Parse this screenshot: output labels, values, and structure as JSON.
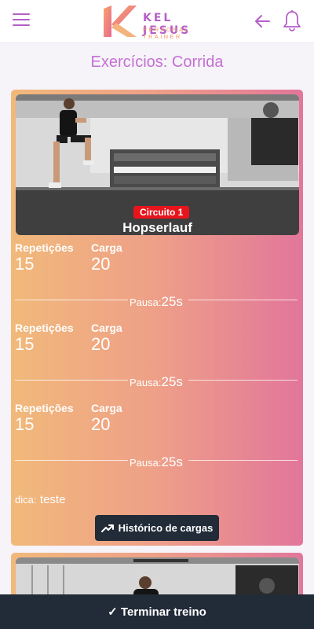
{
  "header": {
    "logo_title": "KEL JESUS",
    "logo_subtitle": "PERSONAL TRAINER",
    "menu_icon": "hamburger-menu-icon",
    "back_icon": "arrow-left-icon",
    "notification_icon": "bell-icon"
  },
  "page_title": "Exercícios: Corrida",
  "exercise": {
    "circuit_label": "Circuito 1",
    "name": "Hopserlauf",
    "sets": [
      {
        "reps_label": "Repetições",
        "reps_value": "15",
        "load_label": "Carga",
        "load_value": "20"
      },
      {
        "reps_label": "Repetições",
        "reps_value": "15",
        "load_label": "Carga",
        "load_value": "20"
      },
      {
        "reps_label": "Repetições",
        "reps_value": "15",
        "load_label": "Carga",
        "load_value": "20"
      }
    ],
    "rests": [
      {
        "label": "Pausa:",
        "value": "25s"
      },
      {
        "label": "Pausa:",
        "value": "25s"
      },
      {
        "label": "Pausa:",
        "value": "25s"
      }
    ],
    "tip_label": "dica:",
    "tip_value": "teste",
    "history_button": "Histórico de cargas"
  },
  "footer": {
    "finish_button": "✓ Terminar treino"
  },
  "colors": {
    "accent": "#b65fc9",
    "logo_orange": "#f09b6b",
    "card_gradient_start": "#f1b97a",
    "card_gradient_end": "#e2769b",
    "dark_button": "#222b38",
    "circuit_badge": "#e8141c"
  }
}
